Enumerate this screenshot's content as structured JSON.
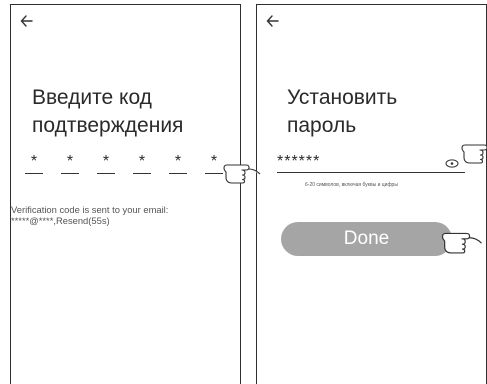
{
  "left_screen": {
    "back_icon": "back-arrow-icon",
    "title_line1": "Введите код",
    "title_line2": "подтверждения",
    "code_digits": [
      "*",
      "*",
      "*",
      "*",
      "*",
      "*"
    ],
    "info_line1": "Verification code is sent to your email:",
    "info_line2": "*****@****,Resend(55s)"
  },
  "right_screen": {
    "back_icon": "back-arrow-icon",
    "title_line1": "Установить",
    "title_line2": "пароль",
    "password_value": "******",
    "eye_icon": "eye-icon",
    "hint": "6-20 символов, включая буквы и цифры",
    "done_label": "Done"
  },
  "colors": {
    "button_bg": "#a5a5a5",
    "button_text": "#ffffff",
    "text": "#2a2a2a",
    "frame": "#2f2f2f"
  },
  "annotations": {
    "pointer_icon": "pointing-hand-icon"
  }
}
